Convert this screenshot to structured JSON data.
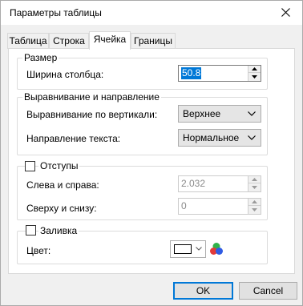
{
  "window": {
    "title": "Параметры таблицы"
  },
  "tabs": [
    {
      "label": "Таблица",
      "active": false
    },
    {
      "label": "Строка",
      "active": false
    },
    {
      "label": "Ячейка",
      "active": true
    },
    {
      "label": "Границы",
      "active": false
    }
  ],
  "size_group": {
    "title": "Размер",
    "column_width_label": "Ширина столбца:",
    "column_width_value": "50.8"
  },
  "alignment_group": {
    "title": "Выравнивание и направление",
    "vertical_label": "Выравнивание по вертикали:",
    "vertical_value": "Верхнее",
    "direction_label": "Направление текста:",
    "direction_value": "Нормальное"
  },
  "padding_group": {
    "title": "Отступы",
    "checked": false,
    "left_right_label": "Слева и справа:",
    "left_right_value": "2.032",
    "top_bottom_label": "Сверху и снизу:",
    "top_bottom_value": "0"
  },
  "fill_group": {
    "title": "Заливка",
    "checked": false,
    "color_label": "Цвет:",
    "color_value": "#ffffff"
  },
  "buttons": {
    "ok": "OK",
    "cancel": "Cancel"
  },
  "colors": {
    "accent": "#0078d7",
    "window_bg": "#f0f0f0"
  }
}
